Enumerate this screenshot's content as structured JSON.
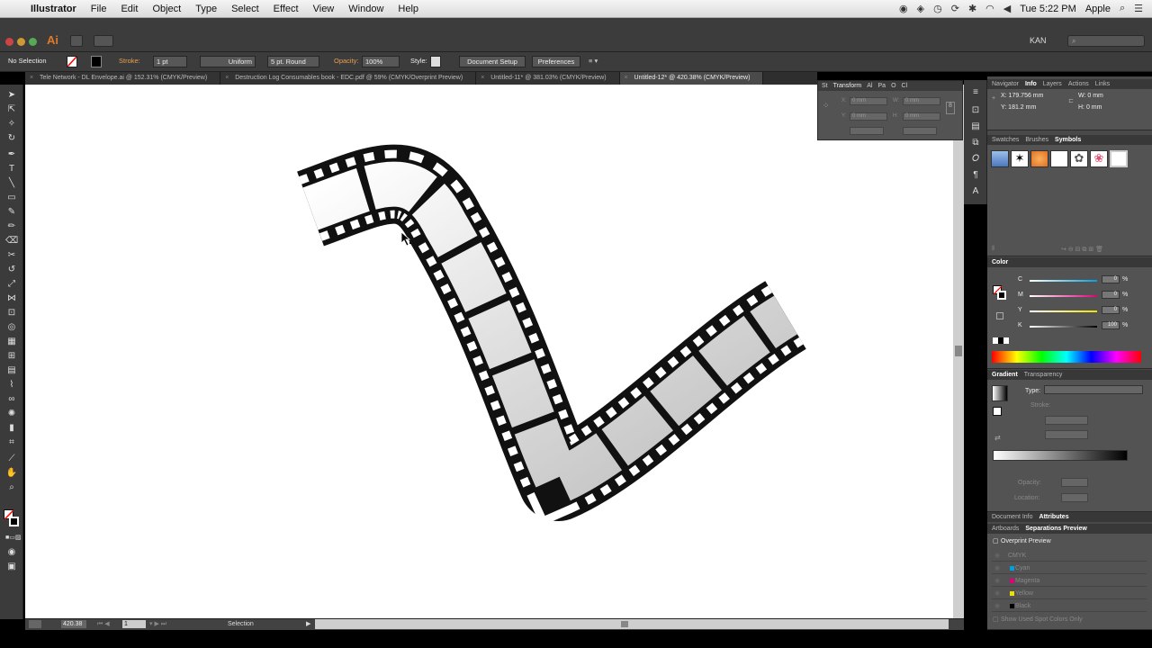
{
  "menubar": {
    "apple_glyph": "",
    "app_name": "Illustrator",
    "menus": [
      "File",
      "Edit",
      "Object",
      "Type",
      "Select",
      "Effect",
      "View",
      "Window",
      "Help"
    ],
    "clock": "Tue 5:22 PM",
    "user": "Apple"
  },
  "appbar": {
    "logo": "Ai",
    "workspace": "KAN"
  },
  "control": {
    "selection": "No Selection",
    "stroke_label": "Stroke:",
    "stroke_weight": "1 pt",
    "profile": "Uniform",
    "brush": "5 pt. Round",
    "opacity_label": "Opacity:",
    "opacity": "100%",
    "style_label": "Style:",
    "document_setup": "Document Setup",
    "preferences": "Preferences"
  },
  "tabs": [
    {
      "label": "Tele Network - DL Envelope.ai @ 152.31% (CMYK/Preview)"
    },
    {
      "label": "Destruction Log Consumables book - EDC.pdf @ 59% (CMYK/Overprint Preview)"
    },
    {
      "label": "Untitled-11* @ 381.03% (CMYK/Preview)"
    },
    {
      "label": "Untitled-12* @ 420.38% (CMYK/Preview)"
    }
  ],
  "transform_panel": {
    "tabs": [
      "St",
      "Transform",
      "Al",
      "Pa",
      "O",
      "Cl"
    ],
    "x_label": "X:",
    "y_label": "Y:",
    "w_label": "W:",
    "h_label": "H:",
    "x": "0 mm",
    "y": "0 mm",
    "w": "0 mm",
    "h": "0 mm"
  },
  "info_panel": {
    "tabs": [
      "Navigator",
      "Info",
      "Layers",
      "Actions",
      "Links"
    ],
    "x": "X: 179.756 mm",
    "y": "Y: 181.2 mm",
    "w": "W: 0 mm",
    "h": "H: 0 mm"
  },
  "symbols_panel": {
    "tabs": [
      "Swatches",
      "Brushes",
      "Symbols"
    ]
  },
  "color_panel": {
    "title": "Color",
    "channels": [
      {
        "name": "C",
        "value": "0",
        "color": "#00a0e0"
      },
      {
        "name": "M",
        "value": "0",
        "color": "#e0007a"
      },
      {
        "name": "Y",
        "value": "0",
        "color": "#f0e000"
      },
      {
        "name": "K",
        "value": "100",
        "color": "#000000"
      }
    ],
    "pct": "%"
  },
  "gradient_panel": {
    "tabs": [
      "Gradient",
      "Transparency"
    ],
    "type_label": "Type:",
    "stroke_label": "Stroke:",
    "opacity_label": "Opacity:",
    "location_label": "Location:"
  },
  "attributes_panel": {
    "tabs": [
      "Document Info",
      "Attributes"
    ]
  },
  "separations_panel": {
    "tabs": [
      "Artboards",
      "Separations Preview"
    ],
    "overprint": "Overprint Preview",
    "rows": [
      {
        "name": "CMYK",
        "color": "#666666"
      },
      {
        "name": "Cyan",
        "color": "#00a0e0"
      },
      {
        "name": "Magenta",
        "color": "#e0007a"
      },
      {
        "name": "Yellow",
        "color": "#f0e000"
      },
      {
        "name": "Black",
        "color": "#000000"
      }
    ],
    "footer": "Show Used Spot Colors Only"
  },
  "status": {
    "zoom": "420.38",
    "artboard": "1",
    "tool": "Selection"
  }
}
